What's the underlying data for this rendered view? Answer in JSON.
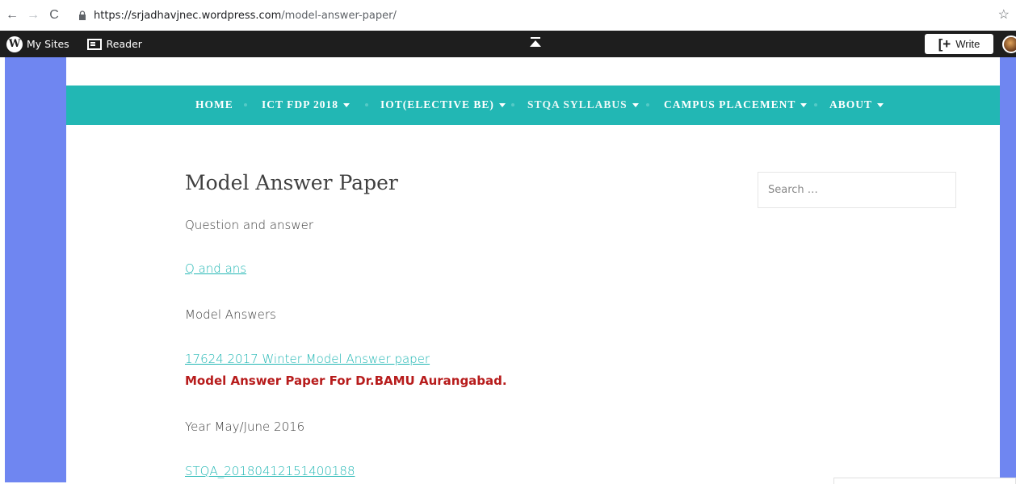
{
  "browser": {
    "url_host": "https://srjadhavjnec.wordpress.com",
    "url_path": "/model-answer-paper/"
  },
  "wpbar": {
    "my_sites": "My Sites",
    "reader": "Reader",
    "write": "Write"
  },
  "menu": {
    "items": [
      {
        "label": "HOME"
      },
      {
        "label": "ICT FDP 2018"
      },
      {
        "label": "IOT(ELECTIVE BE)"
      },
      {
        "label": "STQA SYLLABUS"
      },
      {
        "label": "CAMPUS PLACEMENT"
      },
      {
        "label": "ABOUT"
      }
    ]
  },
  "post": {
    "title": "Model Answer Paper",
    "p1": "Question and answer",
    "link1": "Q and ans",
    "p2": "Model Answers",
    "link2": "17624 2017 Winter Model Answer paper",
    "highlight": "Model Answer Paper For Dr.BAMU Aurangabad.",
    "p3": "Year May/June 2016",
    "link3": "STQA_20180412151400188"
  },
  "search": {
    "placeholder": "Search …"
  },
  "colors": {
    "menu_bg": "#22b7b4",
    "outer_bg": "#6f86f1",
    "admin_bar": "#1e1e1e",
    "highlight_red": "#b71c1c"
  }
}
